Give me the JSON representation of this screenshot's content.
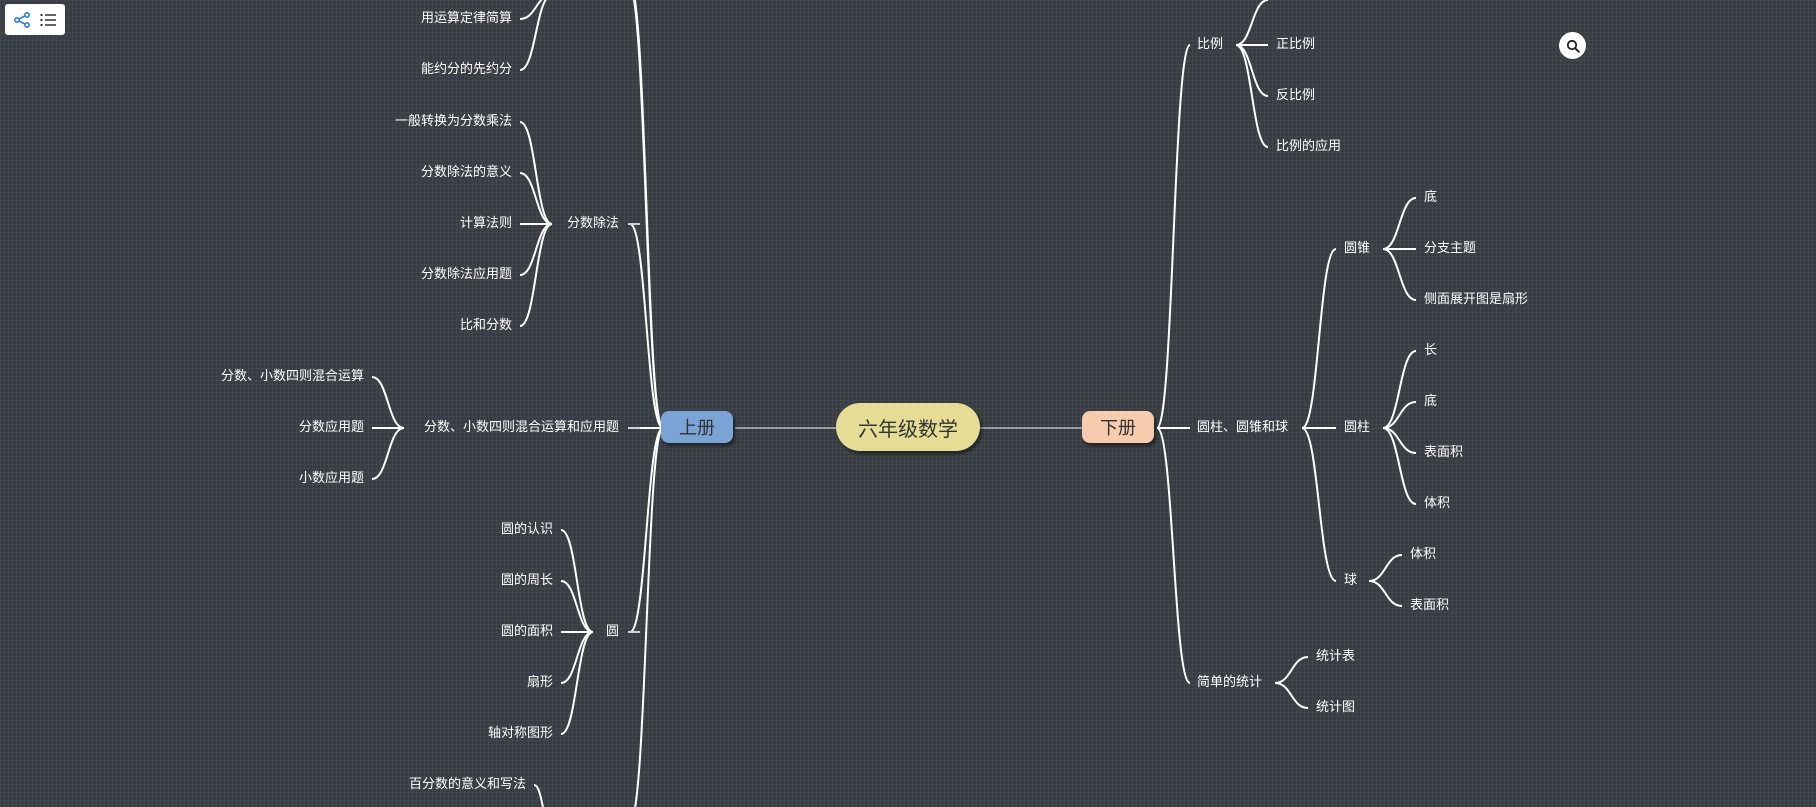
{
  "toolbar": {
    "mindmap_icon": "mindmap-icon",
    "outline_icon": "outline-list-icon"
  },
  "search_icon": "search-icon",
  "root": "六年级数学",
  "left_volume": {
    "label": "上册",
    "partial_items": [
      "用运算定律简算",
      "能约分的先约分"
    ],
    "groups": [
      {
        "label": "分数除法",
        "children": [
          "一般转换为分数乘法",
          "分数除法的意义",
          "计算法则",
          "分数除法应用题",
          "比和分数"
        ]
      },
      {
        "label": "分数、小数四则混合运算和应用题",
        "children": [
          "分数、小数四则混合运算",
          "分数应用题",
          "小数应用题"
        ]
      },
      {
        "label": "圆",
        "children": [
          "圆的认识",
          "圆的周长",
          "圆的面积",
          "扇形",
          "轴对称图形"
        ]
      },
      {
        "label": "",
        "children": [
          "百分数的意义和写法"
        ]
      }
    ]
  },
  "right_volume": {
    "label": "下册",
    "groups": [
      {
        "label": "比例",
        "children": [
          "正比例",
          "反比例",
          "比例的应用"
        ]
      },
      {
        "label": "圆柱、圆锥和球",
        "subgroups": [
          {
            "label": "圆锥",
            "children": [
              "底",
              "分支主题",
              "侧面展开图是扇形"
            ]
          },
          {
            "label": "圆柱",
            "children": [
              "长",
              "底",
              "表面积",
              "体积"
            ]
          },
          {
            "label": "球",
            "children": [
              "体积",
              "表面积"
            ]
          }
        ]
      },
      {
        "label": "简单的统计",
        "children": [
          "统计表",
          "统计图"
        ]
      }
    ]
  },
  "colors": {
    "background": "#373d42",
    "root_fill": "#e5dd96",
    "left_volume_fill": "#7aa3d6",
    "right_volume_fill": "#f7ccae",
    "edge": "#ffffff",
    "toolbar_icon": "#2f7fd6"
  }
}
